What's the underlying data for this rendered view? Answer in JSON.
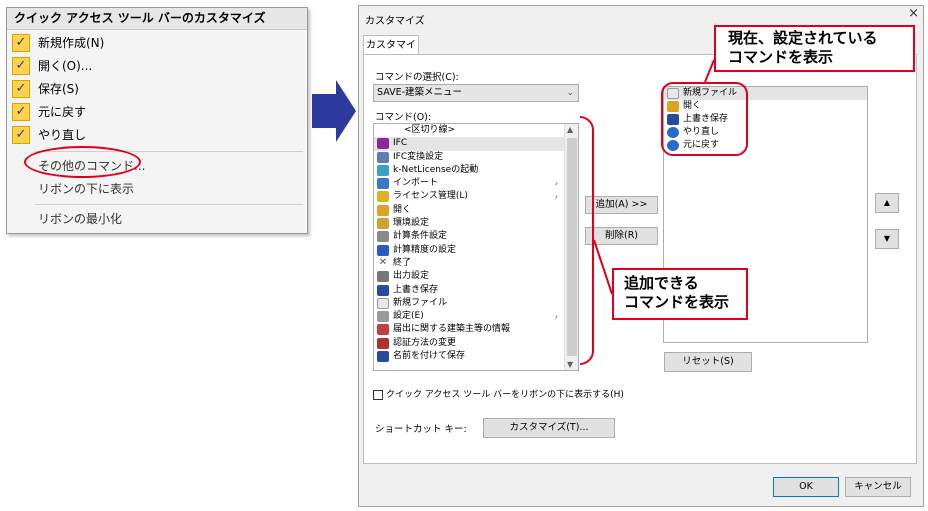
{
  "qat_menu": {
    "title": "クイック アクセス ツール バーのカスタマイズ",
    "checked_items": [
      {
        "label": "新規作成(N)",
        "check": "✓"
      },
      {
        "label": "開く(O)...",
        "check": "✓"
      },
      {
        "label": "保存(S)",
        "check": "✓"
      },
      {
        "label": "元に戻す",
        "check": "✓"
      },
      {
        "label": "やり直し",
        "check": "✓"
      }
    ],
    "other_commands": "その他のコマンド...",
    "show_below": "リボンの下に表示",
    "minimize": "リボンの最小化"
  },
  "dialog": {
    "title": "カスタマイズ",
    "close": "×",
    "tab": "カスタマイズ",
    "choose_label": "コマンドの選択(C):",
    "choose_value": "SAVE-建築メニュー",
    "commands_label": "コマンド(O):",
    "commands": [
      {
        "label": "<区切り線>",
        "icon": "",
        "sub": ""
      },
      {
        "label": "IFC",
        "icon": "#8a2a9a",
        "sub": ""
      },
      {
        "label": "IFC変換設定",
        "icon": "#5a7fb5",
        "sub": ""
      },
      {
        "label": "k-NetLicenseの起動",
        "icon": "#3aa0c8",
        "sub": ""
      },
      {
        "label": "インポート",
        "icon": "#3a78c8",
        "sub": "›"
      },
      {
        "label": "ライセンス管理(L)",
        "icon": "#e0b020",
        "sub": "›"
      },
      {
        "label": "開く",
        "icon": "#e0a020",
        "sub": ""
      },
      {
        "label": "環境設定",
        "icon": "#d0a030",
        "sub": ""
      },
      {
        "label": "計算条件設定",
        "icon": "#8a8a8a",
        "sub": ""
      },
      {
        "label": "計算精度の設定",
        "icon": "#2a5ac8",
        "sub": ""
      },
      {
        "label": "終了",
        "icon": "#555555",
        "sub": ""
      },
      {
        "label": "出力設定",
        "icon": "#777777",
        "sub": ""
      },
      {
        "label": "上書き保存",
        "icon": "#2a4aa0",
        "sub": ""
      },
      {
        "label": "新規ファイル",
        "icon": "#e8e8e8",
        "sub": ""
      },
      {
        "label": "設定(E)",
        "icon": "#999999",
        "sub": "›"
      },
      {
        "label": "届出に関する建築主等の情報",
        "icon": "#c04040",
        "sub": ""
      },
      {
        "label": "認証方法の変更",
        "icon": "#b03030",
        "sub": ""
      },
      {
        "label": "名前を付けて保存",
        "icon": "#2a4aa0",
        "sub": ""
      }
    ],
    "add_button": "追加(A) >>",
    "remove_button": "削除(R)",
    "current_commands": [
      {
        "label": "新規ファイル",
        "icon": "#e8e8e8"
      },
      {
        "label": "開く",
        "icon": "#e0a020"
      },
      {
        "label": "上書き保存",
        "icon": "#2a4aa0"
      },
      {
        "label": "やり直し",
        "icon": "#2a6ac8"
      },
      {
        "label": "元に戻す",
        "icon": "#2a6ac8"
      }
    ],
    "move_up": "▲",
    "move_down": "▼",
    "reset_button": "リセット(S)",
    "show_below_check": "クイック アクセス ツール バーをリボンの下に表示する(H)",
    "shortcut_label": "ショートカット キー:",
    "customize_button": "カスタマイズ(T)...",
    "ok_button": "OK",
    "cancel_button": "キャンセル"
  },
  "notes": {
    "current_line1": "現在、設定されている",
    "current_line2": "コマンドを表示",
    "add_line1": "追加できる",
    "add_line2": "コマンドを表示"
  },
  "colors": {
    "accent_red": "#e0001b",
    "arrow_blue": "#2b3a9c",
    "check_yellow": "#ffd24d"
  }
}
